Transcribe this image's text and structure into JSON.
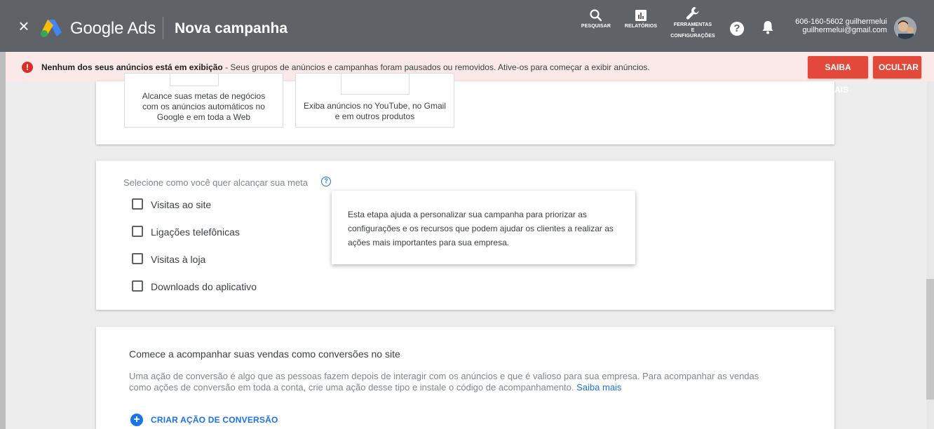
{
  "header": {
    "close_icon": "×",
    "brand": "Google Ads",
    "title": "Nova campanha",
    "tools": {
      "search_label": "PESQUISAR",
      "reports_label": "RELATÓRIOS",
      "tools_label_1": "FERRAMENTAS",
      "tools_label_2": "E",
      "tools_label_3": "CONFIGURAÇÕES"
    },
    "help_glyph": "?",
    "account": {
      "line1": "606-160-5602 guilhermelui",
      "line2": "guilhermelui@gmail.com"
    }
  },
  "banner": {
    "icon": "!",
    "bold": "Nenhum dos seus anúncios está em exibição",
    "text": " - Seus grupos de anúncios e campanhas foram pausados ou removidos. Ative-os para começar a exibir anúncios.",
    "learn_more": "SAIBA MAIS",
    "hide": "OCULTAR"
  },
  "goal_options": [
    {
      "line1": "Alcance suas metas de negócios",
      "line2": "com os anúncios automáticos no",
      "line3": "Google e em toda a Web"
    },
    {
      "line1": "Exiba anúncios no YouTube, no Gmail",
      "line2": "e em outros produtos"
    }
  ],
  "reach": {
    "question": "Selecione como você quer alcançar sua meta",
    "help_glyph": "?",
    "checkboxes": [
      "Visitas ao site",
      "Ligações telefônicas",
      "Visitas à loja",
      "Downloads do aplicativo"
    ],
    "tooltip": "Esta etapa ajuda a personalizar sua campanha para priorizar as configurações e os recursos que podem ajudar os clientes a realizar as ações mais importantes para sua empresa."
  },
  "conversions": {
    "title": "Comece a acompanhar suas vendas como conversões no site",
    "description": "Uma ação de conversão é algo que as pessoas fazem depois de interagir com os anúncios e que é valioso para sua empresa. Para acompanhar as vendas como ações de conversão em toda a conta, crie uma ação desse tipo e instale o código de acompanhamento. ",
    "link": "Saiba mais",
    "plus_glyph": "+",
    "create_button": "CRIAR AÇÃO DE CONVERSÃO"
  },
  "colors": {
    "topbar": "#5f6368",
    "banner_bg": "#fae9e8",
    "error_red": "#d93025",
    "button_red": "#e2493a",
    "link_blue": "#1a73e8"
  }
}
